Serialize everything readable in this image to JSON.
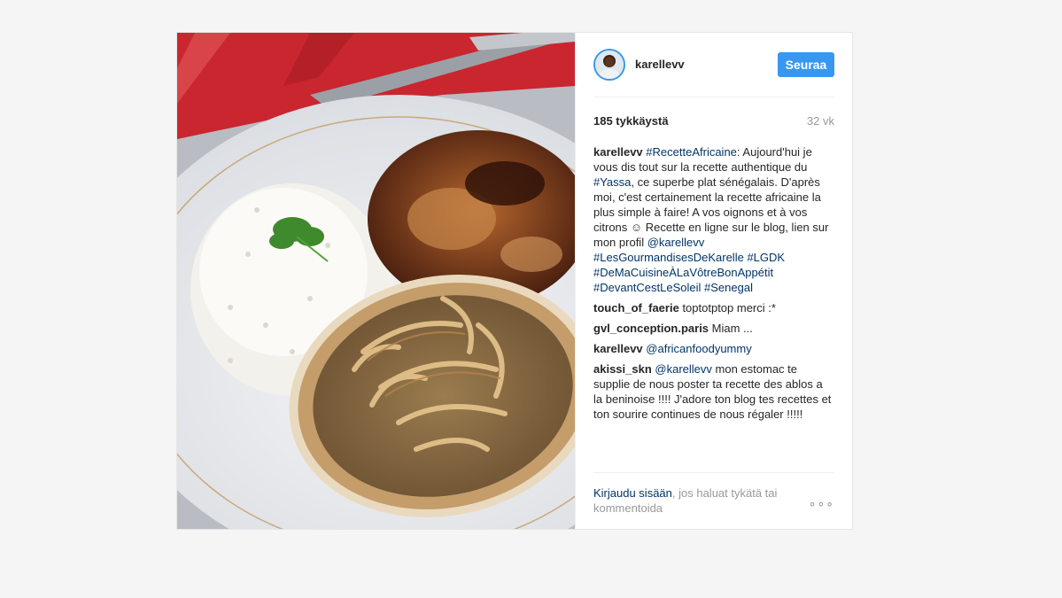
{
  "post": {
    "author": "karellevv",
    "follow_label": "Seuraa",
    "likes": "185 tykkäystä",
    "age": "32 vk",
    "caption_user": "karellevv",
    "caption_parts": [
      {
        "t": "tag",
        "v": "#RecetteAfricaine"
      },
      {
        "t": "text",
        "v": ": Aujourd'hui je vous dis tout sur la recette authentique du "
      },
      {
        "t": "tag",
        "v": "#Yassa"
      },
      {
        "t": "text",
        "v": ", ce superbe plat sénégalais. D'après moi, c'est certainement la recette africaine la plus simple à faire! A vos oignons et à vos citrons ☺ Recette en ligne sur le blog, lien sur mon profil "
      },
      {
        "t": "tag",
        "v": "@karellevv"
      },
      {
        "t": "text",
        "v": " "
      },
      {
        "t": "tag",
        "v": "#LesGourmandisesDeKarelle"
      },
      {
        "t": "text",
        "v": " "
      },
      {
        "t": "tag",
        "v": "#LGDK"
      },
      {
        "t": "text",
        "v": " "
      },
      {
        "t": "tag",
        "v": "#DeMaCuisineÀLaVôtreBonAppétit"
      },
      {
        "t": "text",
        "v": " "
      },
      {
        "t": "tag",
        "v": "#DevantCestLeSoleil"
      },
      {
        "t": "text",
        "v": " "
      },
      {
        "t": "tag",
        "v": "#Senegal"
      }
    ],
    "comments": [
      {
        "user": "touch_of_faerie",
        "parts": [
          {
            "t": "text",
            "v": "toptotptop merci :*"
          }
        ]
      },
      {
        "user": "gvl_conception.paris",
        "parts": [
          {
            "t": "text",
            "v": "Miam ..."
          }
        ]
      },
      {
        "user": "karellevv",
        "parts": [
          {
            "t": "tag",
            "v": "@africanfoodyummy"
          }
        ]
      },
      {
        "user": "akissi_skn",
        "parts": [
          {
            "t": "tag",
            "v": "@karellevv"
          },
          {
            "t": "text",
            "v": " mon estomac te supplie de nous poster ta recette des ablos a la beninoise !!!! J'adore ton blog tes recettes et ton sourire continues de nous régaler !!!!!"
          }
        ]
      }
    ],
    "login_link": "Kirjaudu sisään",
    "login_rest": ", jos haluat tykätä tai kommentoida",
    "more_label": "∘∘∘"
  },
  "colors": {
    "accent": "#3897f0",
    "link": "#003569",
    "muted": "#999999"
  }
}
